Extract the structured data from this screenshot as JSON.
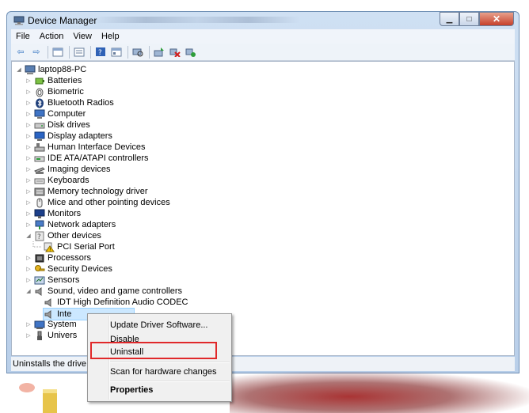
{
  "window": {
    "title": "Device Manager"
  },
  "menu": [
    "File",
    "Action",
    "View",
    "Help"
  ],
  "toolbar_icons": [
    "back-icon",
    "forward-icon",
    "show-hidden-icon",
    "list-icon",
    "help-icon",
    "details-icon",
    "scan-icon",
    "update-driver-icon",
    "uninstall-icon",
    "enable-icon"
  ],
  "tree": {
    "root": "laptop88-PC",
    "items": [
      {
        "label": "Batteries"
      },
      {
        "label": "Biometric"
      },
      {
        "label": "Bluetooth Radios"
      },
      {
        "label": "Computer"
      },
      {
        "label": "Disk drives"
      },
      {
        "label": "Display adapters"
      },
      {
        "label": "Human Interface Devices"
      },
      {
        "label": "IDE ATA/ATAPI controllers"
      },
      {
        "label": "Imaging devices"
      },
      {
        "label": "Keyboards"
      },
      {
        "label": "Memory technology driver"
      },
      {
        "label": "Mice and other pointing devices"
      },
      {
        "label": "Monitors"
      },
      {
        "label": "Network adapters"
      },
      {
        "label": "Other devices"
      },
      {
        "label": "PCI Serial Port"
      },
      {
        "label": "Processors"
      },
      {
        "label": "Security Devices"
      },
      {
        "label": "Sensors"
      },
      {
        "label": "Sound, video and game controllers"
      },
      {
        "label": "IDT High Definition Audio CODEC"
      },
      {
        "label": "Inte"
      },
      {
        "label": "System"
      },
      {
        "label": "Univers"
      }
    ]
  },
  "context_menu": {
    "items": [
      "Update Driver Software...",
      "Disable",
      "Uninstall",
      "Scan for hardware changes",
      "Properties"
    ]
  },
  "status": "Uninstalls the drive",
  "colors": {
    "highlight": "#e0282a",
    "selection": "#cce8ff",
    "close_button": "#c6402b"
  }
}
